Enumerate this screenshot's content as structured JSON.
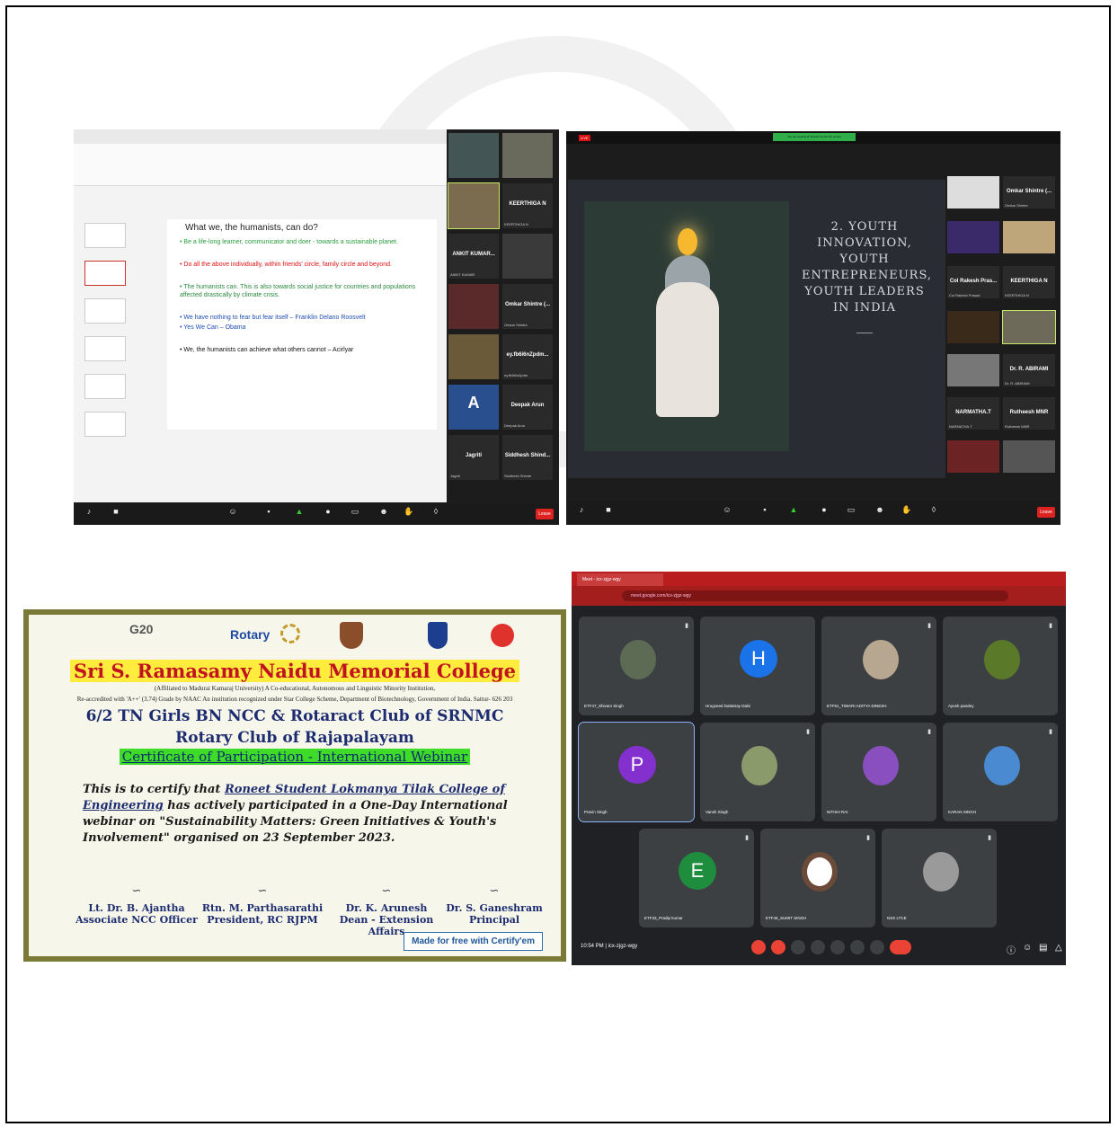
{
  "panel1": {
    "title": "What we, the humanists, can do?",
    "bullets": [
      "• Be a life-long learner, communicator and doer - towards a sustainable planet.",
      "• Do all the above individually, within friends' circle, family circle and beyond.",
      "• The humanists can. This is also towards social justice for countries and populations affected drastically by climate crisis.",
      "• We have nothing to fear but fear itself – Franklin Delano Roosvelt",
      "• Yes We Can – Obama",
      "• We, the humanists can achieve what others cannot – Acirlyar"
    ],
    "tiles": [
      {
        "name": "KEERTHIGA N",
        "sub": "KEERTHIGA N"
      },
      {
        "name": "ANKIT KUMAR...",
        "sub": "ANKIT KUMAR"
      },
      {
        "name": "Omkar Shintre (...",
        "sub": "Omkar Shintre"
      },
      {
        "name": "ey.fb6i6nZpdm...",
        "sub": "ey.fb6i6nZpdm"
      },
      {
        "name": "Deepak Arun",
        "sub": "Deepak Arun"
      },
      {
        "name": "Jagriti",
        "sub": "Jagriti"
      },
      {
        "name": "Siddhesh Shind...",
        "sub": "Siddhesh Shinde"
      }
    ],
    "leave": "Leave"
  },
  "panel2": {
    "live": "LIVE",
    "viewing": "You are viewing Dr Dinesh Kumar R's screen",
    "title_lines": [
      "2. YOUTH",
      "INNOVATION,",
      "YOUTH",
      "ENTREPRENEURS,",
      "YOUTH LEADERS",
      "IN INDIA"
    ],
    "tiles": [
      {
        "name": "Omkar Shintre (...",
        "sub": "Omkar Shintre"
      },
      {
        "name": "Col Rakesh Pras...",
        "sub": "Col Rakesh Prasad"
      },
      {
        "name": "KEERTHIGA N",
        "sub": "KEERTHIGA N"
      },
      {
        "name": "Dr. R. ABIRAMI",
        "sub": "Dr. R. ABIRAMI"
      },
      {
        "name": "NARMATHA.T",
        "sub": "NARMATHA.T"
      },
      {
        "name": "Rutheesh MNR",
        "sub": "Rutheesh MNR"
      }
    ],
    "leave": "Leave"
  },
  "panel3": {
    "logo_g20": "G20",
    "logo_rotary": "Rotary",
    "college": "Sri S. Ramasamy Naidu Memorial College",
    "affiliation_1": "(Affiliated to Madurai Kamaraj University) A Co-educational, Autonomous and Linguistic Minority Institution,",
    "affiliation_2": "Re-accredited with 'A++' (3.74) Grade by NAAC An institution recognized under Star College Scheme, Department of Biotechnology, Government of India. Sattur- 626 203",
    "line1": "6/2 TN Girls BN NCC & Rotaract Club of SRNMC",
    "line2": "Rotary Club of Rajapalayam",
    "cert_title": "Certificate of Participation - International Webinar",
    "body_1": "This is to certify that",
    "body_name": "Roneet Student Lokmanya Tilak College of Engineering",
    "body_2": "has actively participated in a One-Day International webinar on",
    "body_topic": "\"Sustainability Matters: Green Initiatives & Youth's Involvement\"",
    "body_3": "organised on 23 September 2023.",
    "signatures": [
      {
        "name": "Lt. Dr. B. Ajantha",
        "role": "Associate NCC Officer"
      },
      {
        "name": "Rtn. M. Parthasarathi",
        "role": "President, RC RJPM"
      },
      {
        "name": "Dr. K. Arunesh",
        "role": "Dean - Extension Affairs"
      },
      {
        "name": "Dr. S. Ganeshram",
        "role": "Principal"
      }
    ],
    "certify": "Made for free with Certify'em"
  },
  "panel4": {
    "tab": "Meet - icx-zjgz-wgy",
    "url": "meet.google.com/icx-zjgz-wgy",
    "participants": [
      {
        "name": "ETF47_Shivam Singh"
      },
      {
        "name": "Hrugveed Dattatray Dalvi",
        "letter": "H",
        "color": "#1a73e8"
      },
      {
        "name": "ETF51_TIWARI ADITYA DINESH"
      },
      {
        "name": "Ayush pandey"
      },
      {
        "name": "Pravin Singh",
        "letter": "P",
        "color": "#8430ce"
      },
      {
        "name": "Vansh Singh"
      },
      {
        "name": "NITISH RAI"
      },
      {
        "name": "KARAN SINGH"
      },
      {
        "name": "ETF33_Pradip kumar",
        "letter": "E",
        "color": "#1e8e3e"
      },
      {
        "name": "ETF46_SUMIT SINGH"
      },
      {
        "name": "NSS LTCE"
      }
    ],
    "time": "10:54 PM | icx-zjgz-wgy"
  }
}
